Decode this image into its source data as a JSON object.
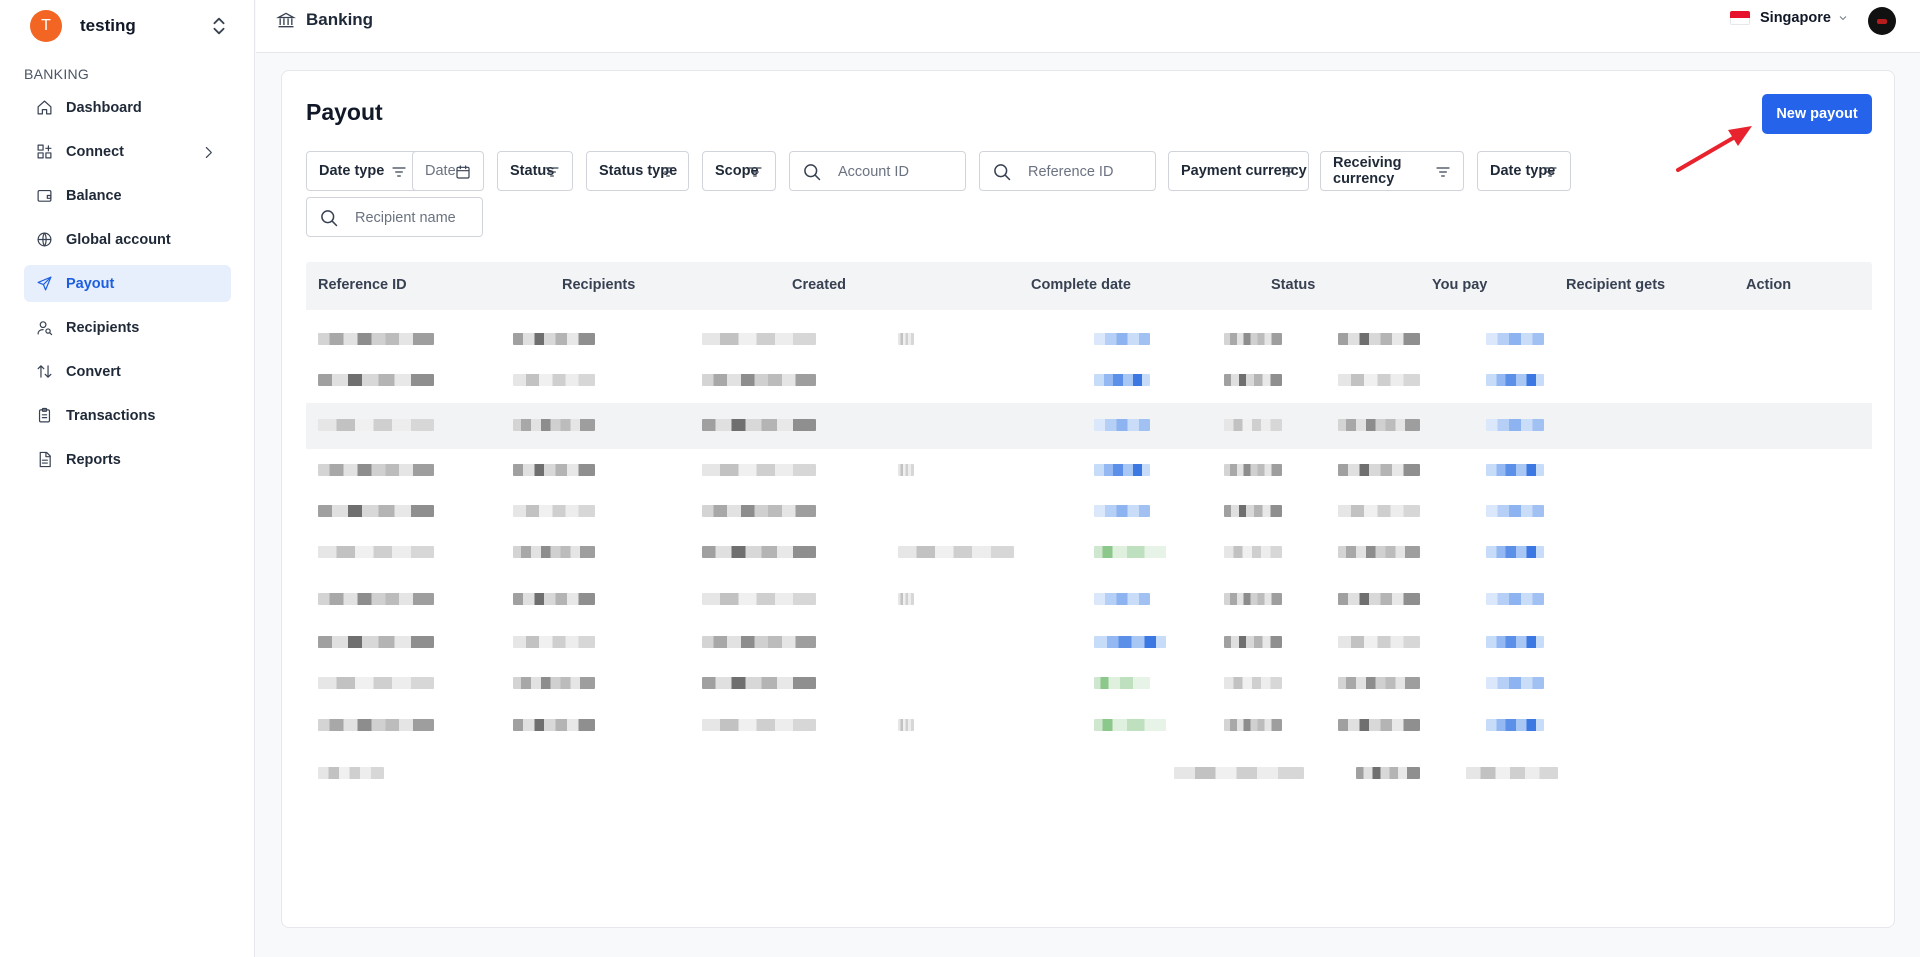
{
  "org": {
    "initial": "T",
    "name": "testing"
  },
  "sidebar": {
    "section_label": "BANKING",
    "items": [
      {
        "label": "Dashboard",
        "icon": "home-icon"
      },
      {
        "label": "Connect",
        "icon": "connect-icon"
      },
      {
        "label": "Balance",
        "icon": "wallet-icon"
      },
      {
        "label": "Global account",
        "icon": "globe-icon"
      },
      {
        "label": "Payout",
        "icon": "send-icon",
        "active": true
      },
      {
        "label": "Recipients",
        "icon": "user-search-icon"
      },
      {
        "label": "Convert",
        "icon": "swap-icon"
      },
      {
        "label": "Transactions",
        "icon": "clipboard-icon"
      },
      {
        "label": "Reports",
        "icon": "file-icon"
      }
    ]
  },
  "header": {
    "breadcrumb": "Banking",
    "region": "Singapore"
  },
  "page": {
    "title": "Payout",
    "new_payout_label": "New payout"
  },
  "filters": {
    "date_type": "Date type",
    "date": "Date",
    "status": "Status",
    "status_type": "Status type",
    "scope": "Scope",
    "account_id_placeholder": "Account ID",
    "reference_id_placeholder": "Reference ID",
    "payment_currency": "Payment currency",
    "receiving_currency": "Receiving currency",
    "date_type_2": "Date type",
    "recipient_name_placeholder": "Recipient name"
  },
  "table": {
    "columns": [
      "Reference ID",
      "Recipients",
      "Created",
      "Complete date",
      "Status",
      "You pay",
      "Recipient gets",
      "Action"
    ]
  },
  "colors": {
    "accent": "#2563eb",
    "avatar": "#f26522",
    "active_bg": "#e7effc"
  }
}
